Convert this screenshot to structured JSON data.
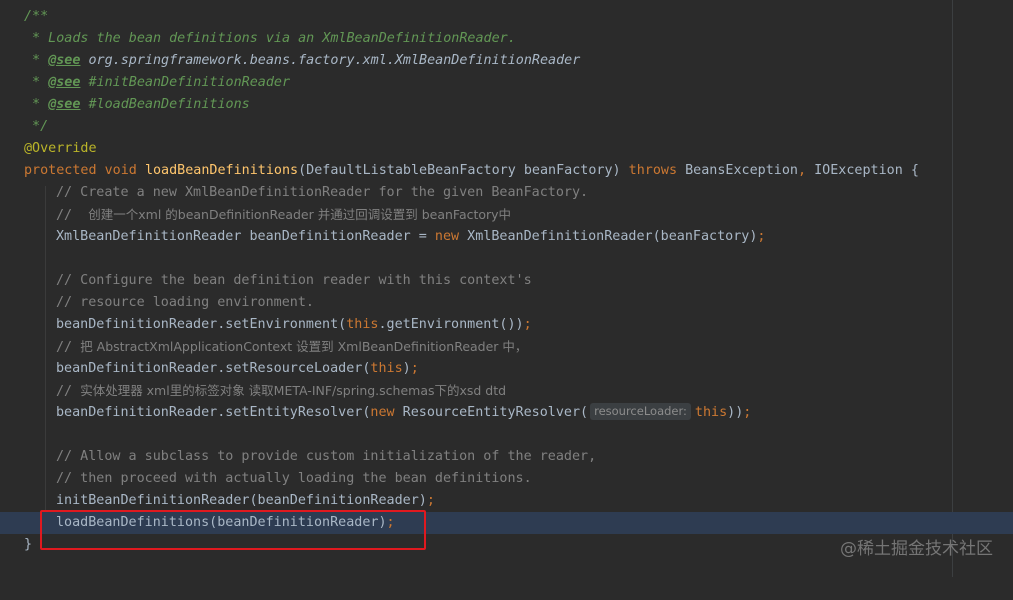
{
  "code": {
    "javadoc": {
      "open": "/**",
      "summary": " * Loads the bean definitions via an XmlBeanDefinitionReader.",
      "see1_prefix": " * ",
      "see_tag": "@see",
      "see1_ref": " org.springframework.beans.factory.xml.XmlBeanDefinitionReader",
      "see2_ref": " #initBeanDefinitionReader",
      "see3_ref": " #loadBeanDefinitions",
      "close": " */"
    },
    "annotation": "@Override",
    "signature": {
      "modifier": "protected",
      "return_type": " void ",
      "method": "loadBeanDefinitions",
      "params": "(DefaultListableBeanFactory beanFactory) ",
      "throws_kw": "throws",
      "exceptions": " BeansException",
      "comma": ", ",
      "exception2": "IOException {"
    },
    "body": {
      "c1": "// Create a new XmlBeanDefinitionReader for the given BeanFactory.",
      "c2_prefix": "//  ",
      "c2_text": "创建一个xml 的beanDefinitionReader 并通过回调设置到 beanFactory中",
      "s1_a": "XmlBeanDefinitionReader beanDefinitionReader = ",
      "s1_new": "new",
      "s1_b": " XmlBeanDefinitionReader(beanFactory)",
      "s1_semi": ";",
      "c3": "// Configure the bean definition reader with this context's",
      "c4": "// resource loading environment.",
      "s2_a": "beanDefinitionReader.setEnvironment(",
      "s2_this": "this",
      "s2_b": ".getEnvironment())",
      "s2_semi": ";",
      "c5_prefix": "// ",
      "c5_text": "把 AbstractXmlApplicationContext 设置到 XmlBeanDefinitionReader 中，",
      "s3_a": "beanDefinitionReader.setResourceLoader(",
      "s3_this": "this",
      "s3_b": ")",
      "s3_semi": ";",
      "c6_prefix": "// ",
      "c6_text": "实体处理器 xml里的标签对象 读取META-INF/spring.schemas下的xsd dtd",
      "s4_a": "beanDefinitionReader.setEntityResolver(",
      "s4_new": "new",
      "s4_b": " ResourceEntityResolver(",
      "s4_hint": "resourceLoader:",
      "s4_this": "this",
      "s4_c": "))",
      "s4_semi": ";",
      "c7": "// Allow a subclass to provide custom initialization of the reader,",
      "c8": "// then proceed with actually loading the bean definitions.",
      "s5": "initBeanDefinitionReader(beanDefinitionReader)",
      "s5_semi": ";",
      "s6": "loadBeanDefinitions(beanDefinitionReader)",
      "s6_semi": ";"
    },
    "close_brace": "}"
  },
  "watermark": "@稀土掘金技术社区",
  "colors": {
    "background": "#2b2b2b",
    "keyword": "#cc7832",
    "method": "#ffc66d",
    "comment": "#808080",
    "doc": "#629755",
    "annotation": "#bbb529",
    "highlight_line": "#2e3c52",
    "red_box": "#e0191f"
  }
}
